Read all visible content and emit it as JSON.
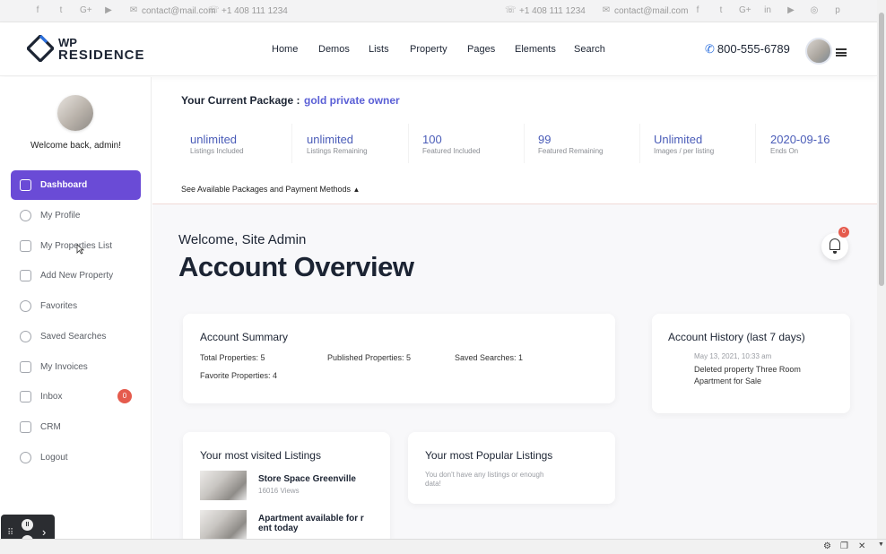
{
  "topbar": {
    "left_email": "contact@mail.com",
    "left_phone": "+1 408 111 1234",
    "right_phone": "+1 408 111 1234",
    "right_email": "contact@mail.com",
    "social_left": [
      "facebook-icon",
      "twitter-icon",
      "google-plus-icon",
      "youtube-icon"
    ],
    "social_right": [
      "facebook-icon",
      "twitter-icon",
      "google-plus-icon",
      "linkedin-icon",
      "youtube-icon",
      "instagram-icon",
      "pinterest-icon"
    ]
  },
  "header": {
    "logo_line1": "WP",
    "logo_line2": "RESIDENCE",
    "nav": [
      "Home",
      "Demos",
      "Lists",
      "Property",
      "Pages",
      "Elements",
      "Search"
    ],
    "phone": "800-555-6789",
    "accent_color": "#2b6fdd"
  },
  "sidebar": {
    "welcome": "Welcome back, admin!",
    "items": [
      {
        "label": "Dashboard",
        "icon": "chart-icon",
        "active": true
      },
      {
        "label": "My Profile",
        "icon": "user-icon"
      },
      {
        "label": "My Properties List",
        "icon": "home-icon"
      },
      {
        "label": "Add New Property",
        "icon": "plus-icon"
      },
      {
        "label": "Favorites",
        "icon": "heart-icon"
      },
      {
        "label": "Saved Searches",
        "icon": "search-icon"
      },
      {
        "label": "My Invoices",
        "icon": "invoice-icon"
      },
      {
        "label": "Inbox",
        "icon": "mail-icon",
        "badge": "0"
      },
      {
        "label": "CRM",
        "icon": "crm-icon"
      },
      {
        "label": "Logout",
        "icon": "logout-icon"
      }
    ],
    "active_color": "#6a4bd6"
  },
  "package": {
    "title": "Your Current Package :",
    "name": "gold private owner",
    "stats": [
      {
        "value": "unlimited",
        "label": "Listings Included"
      },
      {
        "value": "unlimited",
        "label": "Listings Remaining"
      },
      {
        "value": "100",
        "label": "Featured Included"
      },
      {
        "value": "99",
        "label": "Featured Remaining"
      },
      {
        "value": "Unlimited",
        "label": "Images / per listing"
      },
      {
        "value": "2020-09-16",
        "label": "Ends On"
      }
    ],
    "see_link": "See Available Packages and Payment Methods"
  },
  "main": {
    "welcome": "Welcome, Site Admin",
    "title": "Account Overview",
    "notification_count": "0"
  },
  "summary": {
    "title": "Account Summary",
    "total": "Total Properties: 5",
    "published": "Published Properties: 5",
    "saved": "Saved Searches: 1",
    "favorite": "Favorite Properties: 4"
  },
  "history": {
    "title": "Account History (last 7 days)",
    "date": "May 13, 2021, 10:33 am",
    "event_line1": "Deleted property Three Room",
    "event_line2": "Apartment for Sale"
  },
  "visited": {
    "title": "Your most visited Listings",
    "items": [
      {
        "name": "Store Space Greenville",
        "views": "16016 Views"
      },
      {
        "name_line1": "Apartment available for r",
        "name_line2": "ent today"
      }
    ]
  },
  "popular": {
    "title": "Your most Popular Listings",
    "empty_line1": "You don't have any listings or enough",
    "empty_line2": "data!"
  }
}
